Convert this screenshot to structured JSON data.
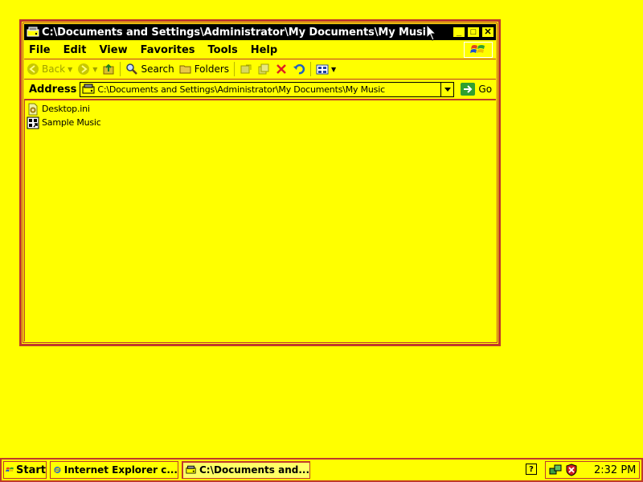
{
  "window": {
    "title": "C:\\Documents and Settings\\Administrator\\My Documents\\My Music",
    "controls": {
      "minimize": "_",
      "maximize": "□",
      "close": "✕"
    }
  },
  "menu": [
    "File",
    "Edit",
    "View",
    "Favorites",
    "Tools",
    "Help"
  ],
  "toolbar": {
    "back": "Back",
    "search": "Search",
    "folders": "Folders"
  },
  "address": {
    "label": "Address",
    "value": "C:\\Documents and Settings\\Administrator\\My Documents\\My Music",
    "go": "Go"
  },
  "files": [
    {
      "name": "Desktop.ini",
      "icon": "settings-file-icon"
    },
    {
      "name": "Sample Music",
      "icon": "shortcut-folder-icon"
    }
  ],
  "taskbar": {
    "start": "Start",
    "tasks": [
      {
        "label": "Internet Explorer c...",
        "icon": "ie-icon"
      },
      {
        "label": "C:\\Documents and...",
        "icon": "explorer-icon"
      }
    ],
    "help": "?",
    "clock": "2:32 PM"
  },
  "colors": {
    "background": "#ffff00",
    "border": "#c0392b",
    "titlebar": "#000000"
  }
}
